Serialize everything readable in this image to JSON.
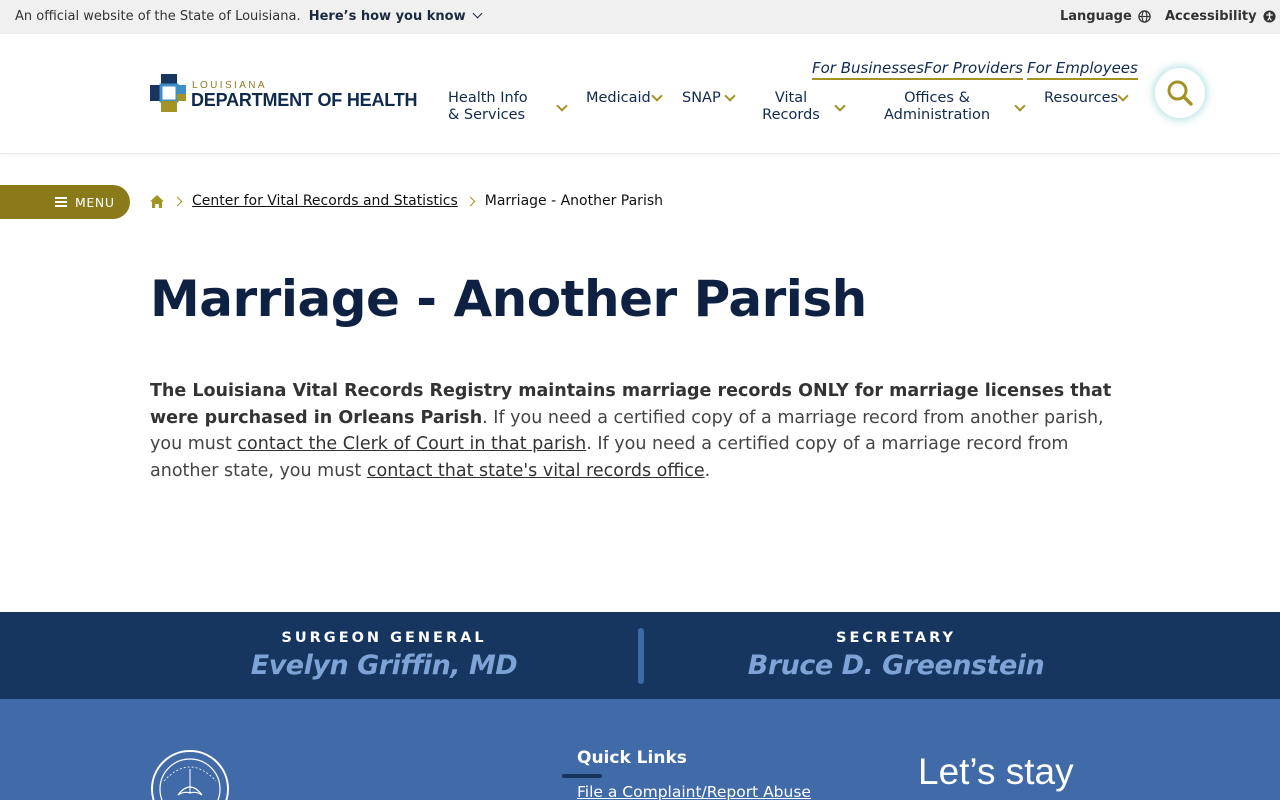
{
  "gov_banner": {
    "text": "An official website of the State of Louisiana.",
    "how_link": "Here’s how you know",
    "language": "Language",
    "accessibility": "Accessibility"
  },
  "header": {
    "logo_small": "LOUISIANA",
    "logo_big": "DEPARTMENT OF HEALTH",
    "utility_links": [
      "For Businesses",
      "For Providers",
      "For Employees"
    ],
    "nav": [
      {
        "line1": "Health Info",
        "line2": "& Services"
      },
      {
        "line1": "Medicaid",
        "line2": ""
      },
      {
        "line1": "SNAP",
        "line2": ""
      },
      {
        "line1": "Vital",
        "line2": "Records"
      },
      {
        "line1": "Offices &",
        "line2": "Administration"
      },
      {
        "line1": "Resources",
        "line2": ""
      }
    ]
  },
  "menu": {
    "label": "MENU"
  },
  "breadcrumb": {
    "parent": "Center for Vital Records and Statistics",
    "current": "Marriage - Another Parish"
  },
  "main": {
    "title": "Marriage - Another Parish",
    "intro_bold": "The Louisiana Vital Records Registry maintains marriage records ONLY for marriage licenses that were purchased in Orleans Parish",
    "intro_text1": ". If you need a certified copy of a marriage record from another parish, you must ",
    "intro_link1": "contact the Clerk of Court in that parish",
    "intro_text2": ". If you need a certified copy of a marriage record from another state, you must ",
    "intro_link2": "contact that state's vital records office",
    "intro_text3": "."
  },
  "leaders": {
    "surgeon_role": "SURGEON GENERAL",
    "surgeon_name": "Evelyn Griffin, MD",
    "secretary_role": "SECRETARY",
    "secretary_name": "Bruce D. Greenstein"
  },
  "footer": {
    "quick_links_title": "Quick Links",
    "quick_link_1": "File a Complaint/Report Abuse",
    "stay_text": "Let’s stay"
  },
  "colors": {
    "navy": "#102a4e",
    "gold": "#a39224",
    "band": "#163660",
    "footer": "#416ba8"
  }
}
